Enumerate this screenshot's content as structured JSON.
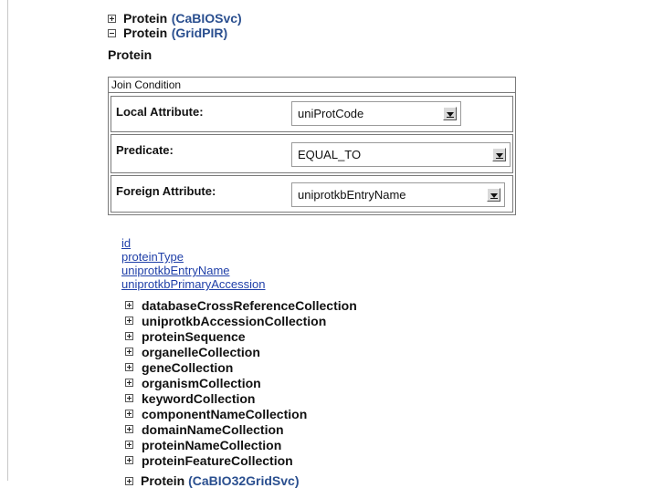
{
  "tree": {
    "top_nodes": [
      {
        "name": "Protein",
        "service": "(CaBIOSvc)",
        "expanded": false
      },
      {
        "name": "Protein",
        "service": "(GridPIR)",
        "expanded": true
      }
    ],
    "section_label": "Protein"
  },
  "join": {
    "header": "Join Condition",
    "local_attribute": {
      "label": "Local Attribute:",
      "value": "uniProtCode"
    },
    "predicate": {
      "label": "Predicate:",
      "value": "EQUAL_TO"
    },
    "foreign_attribute": {
      "label": "Foreign Attribute:",
      "value": "uniprotkbEntryName"
    }
  },
  "attribute_links": [
    "id",
    "proteinType",
    "uniprotkbEntryName",
    "uniprotkbPrimaryAccession"
  ],
  "collections": [
    "databaseCrossReferenceCollection",
    "uniprotkbAccessionCollection",
    "proteinSequence",
    "organelleCollection",
    "geneCollection",
    "organismCollection",
    "keywordCollection",
    "componentNameCollection",
    "domainNameCollection",
    "proteinNameCollection",
    "proteinFeatureCollection"
  ],
  "partial_bottom_node": {
    "name": "Protein",
    "service": "(CaBIO32GridSvc)"
  },
  "icons": {
    "expand": "plus-box-icon",
    "collapse": "minus-box-icon",
    "dropdown": "dropdown-arrow-icon"
  }
}
